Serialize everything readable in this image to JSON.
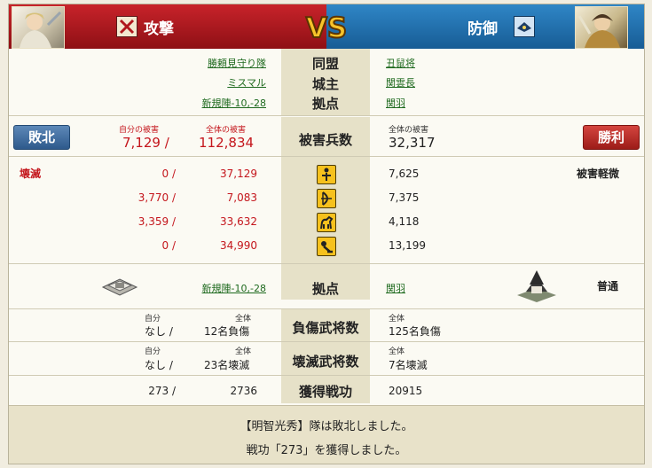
{
  "header": {
    "attack_label": "攻撃",
    "defense_label": "防御",
    "vs_label": "VS"
  },
  "info": {
    "alliance_label": "同盟",
    "lord_label": "城主",
    "base_label": "拠点",
    "attacker_alliance": "勝頼見守り隊",
    "attacker_lord": "ミスマル",
    "attacker_base": "新規陣-10,-28",
    "defender_alliance": "丑鼠将",
    "defender_lord": "関雲長",
    "defender_base": "関羽"
  },
  "casualties": {
    "label": "被害兵数",
    "own_damage_label": "自分の被害",
    "total_damage_label": "全体の被害",
    "defender_total_label": "全体の被害",
    "attacker_own": "7,129 /",
    "attacker_total": "112,834",
    "defender_total": "32,317",
    "attacker_result": "敗北",
    "defender_result": "勝利"
  },
  "units": {
    "attacker_status": "壊滅",
    "defender_status": "被害軽微",
    "rows": [
      {
        "own": "0 /",
        "total": "37,129",
        "defender": "7,625",
        "icon": "spear-icon"
      },
      {
        "own": "3,770 /",
        "total": "7,083",
        "defender": "7,375",
        "icon": "bow-icon"
      },
      {
        "own": "3,359 /",
        "total": "33,632",
        "defender": "4,118",
        "icon": "horse-icon"
      },
      {
        "own": "0 /",
        "total": "34,990",
        "defender": "13,199",
        "icon": "catapult-icon"
      }
    ]
  },
  "base": {
    "label": "拠点",
    "attacker_base": "新規陣-10,-28",
    "defender_base": "関羽",
    "defender_status": "普通"
  },
  "generals": {
    "injured_label": "負傷武将数",
    "destroyed_label": "壊滅武将数",
    "own_label": "自分",
    "total_label": "全体",
    "attacker_injured_own": "なし /",
    "attacker_injured_total": "12名負傷",
    "defender_injured_total": "125名負傷",
    "attacker_destroyed_own": "なし /",
    "attacker_destroyed_total": "23名壊滅",
    "defender_destroyed_total": "7名壊滅"
  },
  "merit": {
    "label": "獲得戦功",
    "attacker_own": "273 /",
    "attacker_total": "2736",
    "defender": "20915"
  },
  "footer": {
    "line1": "【明智光秀】隊は敗北しました。",
    "line2": "戦功「273」を獲得しました。"
  },
  "colors": {
    "attack_red": "#c8232a",
    "defense_blue": "#2f86c6",
    "loss_badge": "#3f6fa3",
    "win_badge": "#b9302a"
  }
}
